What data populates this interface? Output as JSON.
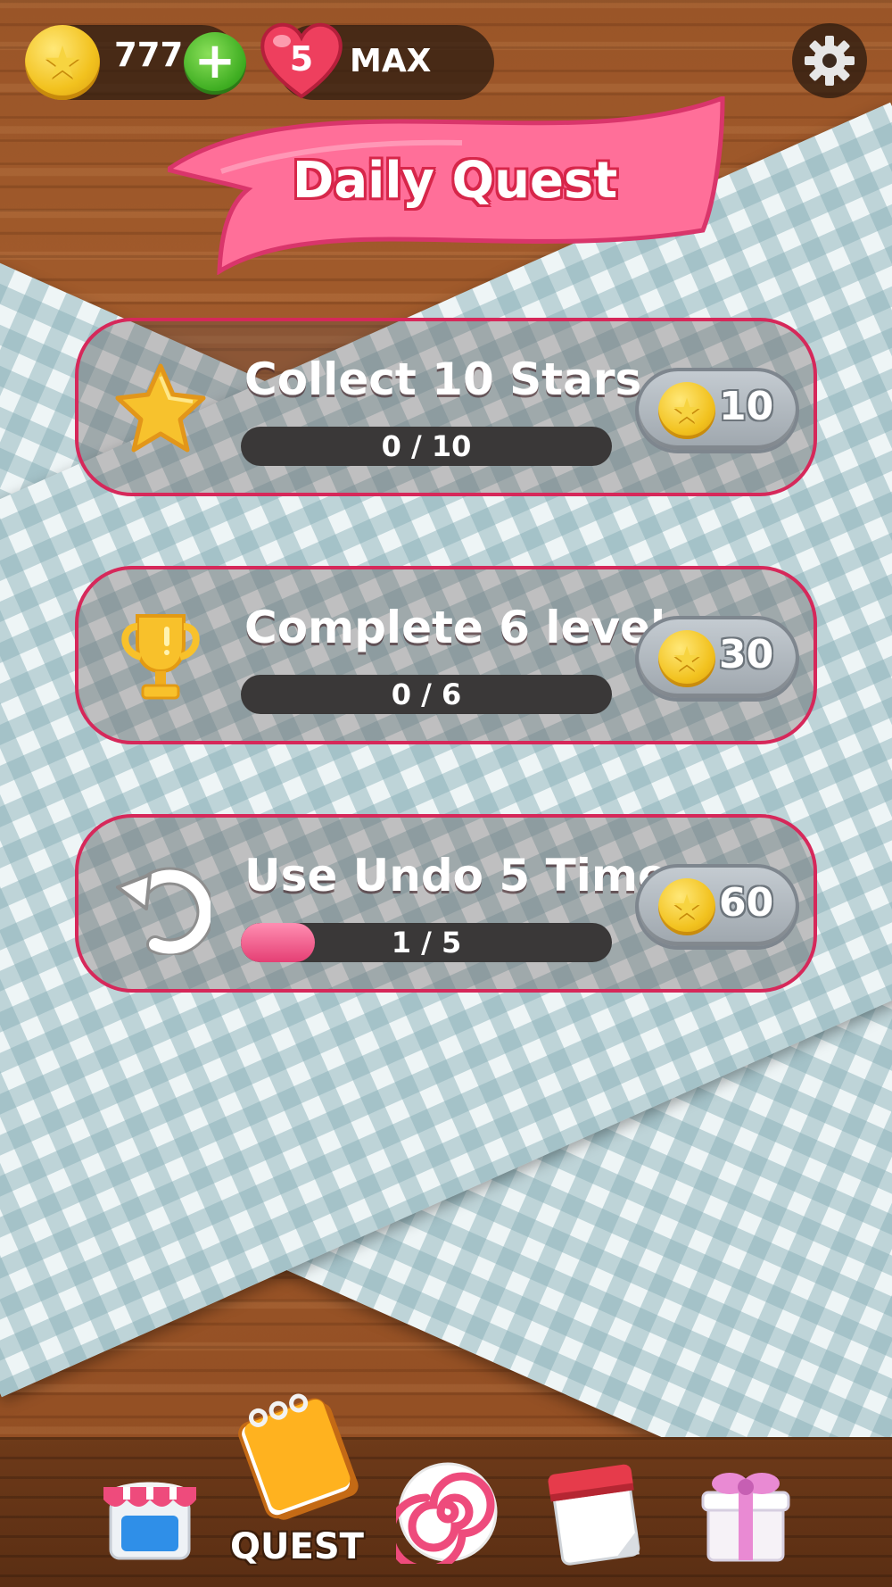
{
  "topbar": {
    "coins": "777",
    "lives": "5",
    "lives_status": "MAX"
  },
  "banner": {
    "title": "Daily Quest"
  },
  "quests": [
    {
      "title": "Collect 10 Stars",
      "progress_text": "0 / 10",
      "progress_fraction": 0.0,
      "reward": "10",
      "icon": "star-icon"
    },
    {
      "title": "Complete 6 levels",
      "progress_text": "0 / 6",
      "progress_fraction": 0.0,
      "reward": "30",
      "icon": "trophy-icon"
    },
    {
      "title": "Use Undo 5 Times",
      "progress_text": "1 / 5",
      "progress_fraction": 0.2,
      "reward": "60",
      "icon": "undo-icon"
    }
  ],
  "nav": {
    "active_label": "QUEST",
    "items": [
      "shop-icon",
      "quest-icon",
      "candy-icon",
      "calendar-icon",
      "gift-icon"
    ]
  },
  "colors": {
    "accent_pink": "#e53f74",
    "card_border": "#d6285a",
    "coin_gold": "#f2c21f",
    "wood": "#a0592a"
  }
}
